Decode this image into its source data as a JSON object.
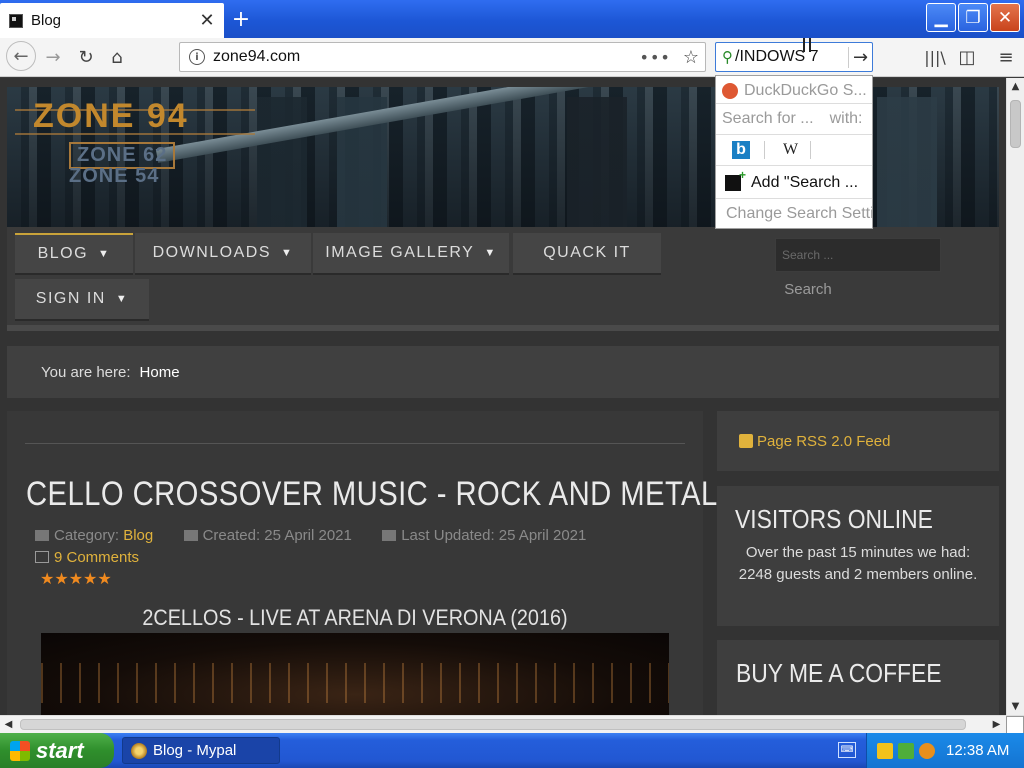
{
  "browser": {
    "tab_title": "Blog",
    "tab_close": "✕",
    "new_tab": "+",
    "url": "zone94.com",
    "page_actions": "•••",
    "search_query": "/INDOWS  7",
    "window_controls": {
      "minimize": "▁",
      "maximize": "❐",
      "close": "✕"
    },
    "icons": {
      "back": "←",
      "forward": "→",
      "reload": "↻",
      "home": "⌂",
      "info": "i",
      "star": "☆",
      "search": "⚲",
      "go": "→",
      "library": "|||\\",
      "sidebar": "◫",
      "menu": "≡"
    }
  },
  "search_dropdown": {
    "engine_name": "DuckDuckGo S...",
    "search_for": "Search for ...",
    "with": "with:",
    "engine_bing": "b",
    "engine_wiki": "W",
    "add_search": "Add \"Search ...",
    "change_settings": "Change Search Settings"
  },
  "site": {
    "logo": {
      "primary": "ZONE 94",
      "secondary_1": "ZONE 62",
      "secondary_2": "ZONE 54"
    },
    "menu": [
      {
        "label": "BLOG",
        "has_caret": true,
        "active": true
      },
      {
        "label": "DOWNLOADS",
        "has_caret": true
      },
      {
        "label": "IMAGE GALLERY",
        "has_caret": true
      },
      {
        "label": "QUACK IT",
        "has_caret": false
      },
      {
        "label": "SIGN IN",
        "has_caret": true
      }
    ],
    "caret": "▼",
    "search_placeholder": "Search ...",
    "search_button": "Search",
    "breadcrumb": {
      "prefix": "You are here:",
      "current": "Home"
    }
  },
  "article": {
    "title": "CELLO CROSSOVER MUSIC - ROCK AND METAL",
    "category_label": "Category:",
    "category": "Blog",
    "created": "Created: 25 April 2021",
    "updated": "Last Updated: 25 April 2021",
    "comments": "9 Comments",
    "rating": 5,
    "stars": "★★★★★",
    "video_title": "2CELLOS - LIVE AT ARENA DI VERONA (2016)"
  },
  "sidebar": {
    "rss": "Page RSS 2.0 Feed",
    "visitors_title": "VISITORS ONLINE",
    "visitors_text": "Over the past 15 minutes we had: 2248 guests and 2 members online.",
    "coffee_title": "BUY ME A COFFEE"
  },
  "scrollbars": {
    "up": "▲",
    "down": "▼",
    "left": "◀",
    "right": "▶"
  },
  "taskbar": {
    "start": "start",
    "task": "Blog - Mypal",
    "keyboard": "⌨",
    "clock": "12:38 AM"
  }
}
